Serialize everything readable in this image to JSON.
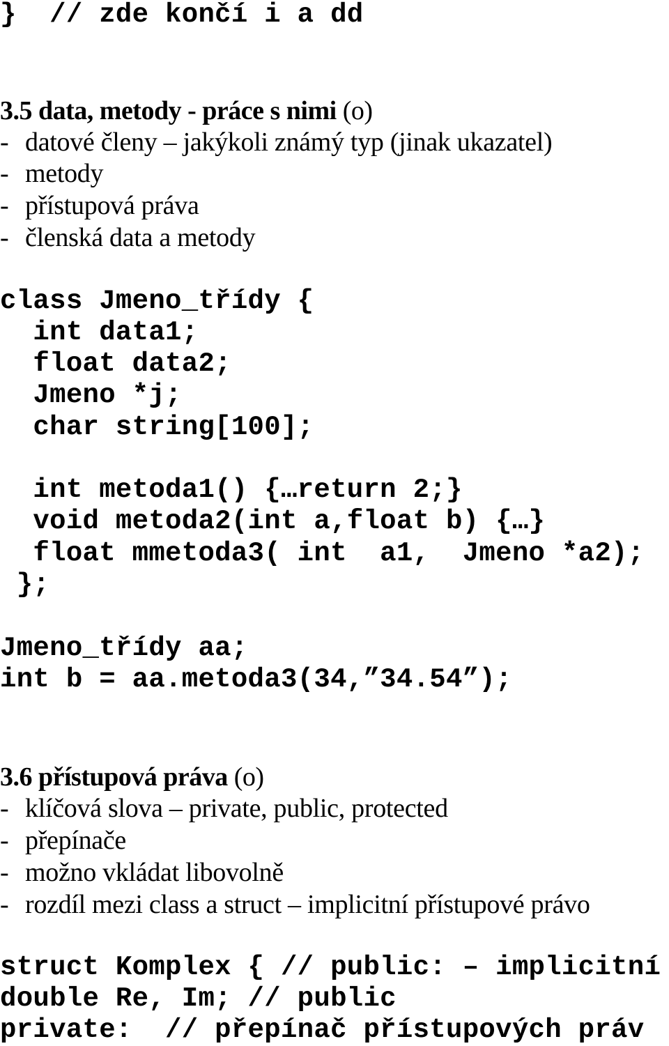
{
  "top_code": {
    "line": "}  // zde končí i a dd"
  },
  "section_35": {
    "heading_main": "3.5 data, metody - práce s nimi ",
    "heading_paren": "(o)",
    "bullets": [
      {
        "dash": "-",
        "text": "datové členy – jakýkoli známý typ (jinak ukazatel)"
      },
      {
        "dash": "-",
        "text": "metody"
      },
      {
        "dash": "-",
        "text": "přístupová práva"
      },
      {
        "dash": "-",
        "text": "členská data a metody"
      }
    ],
    "code_lines": [
      "class Jmeno_třídy {",
      "  int data1;",
      "  float data2;",
      "  Jmeno *j;",
      "  char string[100];",
      "",
      "  int metoda1() {…return 2;}",
      "  void metoda2(int a,float b) {…}",
      "  float mmetoda3( int  a1,  Jmeno *a2);",
      " };",
      "",
      "Jmeno_třídy aa;",
      "int b = aa.metoda3(34,”34.54”);"
    ]
  },
  "section_36": {
    "heading_main": "3.6 přístupová práva ",
    "heading_paren": "(o)",
    "bullets": [
      {
        "dash": "-",
        "text": "klíčová slova – private, public, protected"
      },
      {
        "dash": "-",
        "text": "přepínače"
      },
      {
        "dash": "-",
        "text": "možno vkládat libovolně"
      },
      {
        "dash": "-",
        "text": "rozdíl mezi class a struct – implicitní přístupové právo"
      }
    ],
    "code_lines": [
      "struct Komplex { // public: – implicitní",
      "double Re, Im; // public",
      "private:  // přepínač přístupových práv"
    ]
  }
}
